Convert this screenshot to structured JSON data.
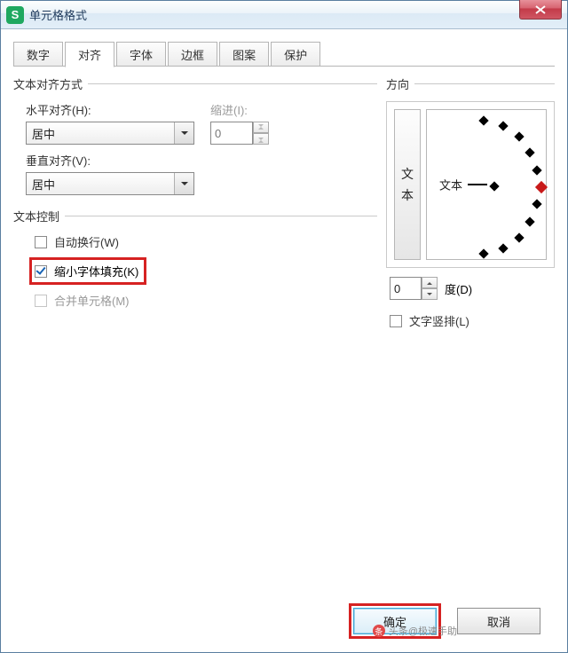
{
  "window": {
    "title": "单元格格式"
  },
  "close_x": "X",
  "tabs": {
    "t0": "数字",
    "t1": "对齐",
    "t2": "字体",
    "t3": "边框",
    "t4": "图案",
    "t5": "保护"
  },
  "align_group": {
    "title": "文本对齐方式",
    "h_label": "水平对齐(H):",
    "h_value": "居中",
    "v_label": "垂直对齐(V):",
    "v_value": "居中",
    "indent_label": "缩进(I):",
    "indent_value": "0"
  },
  "control_group": {
    "title": "文本控制",
    "wrap": "自动换行(W)",
    "shrink": "缩小字体填充(K)",
    "merge": "合并单元格(M)"
  },
  "direction_group": {
    "title": "方向",
    "vbtn_c1": "文",
    "vbtn_c2": "本",
    "dial_text": "文本",
    "degree_value": "0",
    "degree_label": "度(D)",
    "vertical_cb": "文字竖排(L)"
  },
  "footer": {
    "ok": "确定",
    "cancel": "取消"
  },
  "watermark": "头条@极速手助"
}
